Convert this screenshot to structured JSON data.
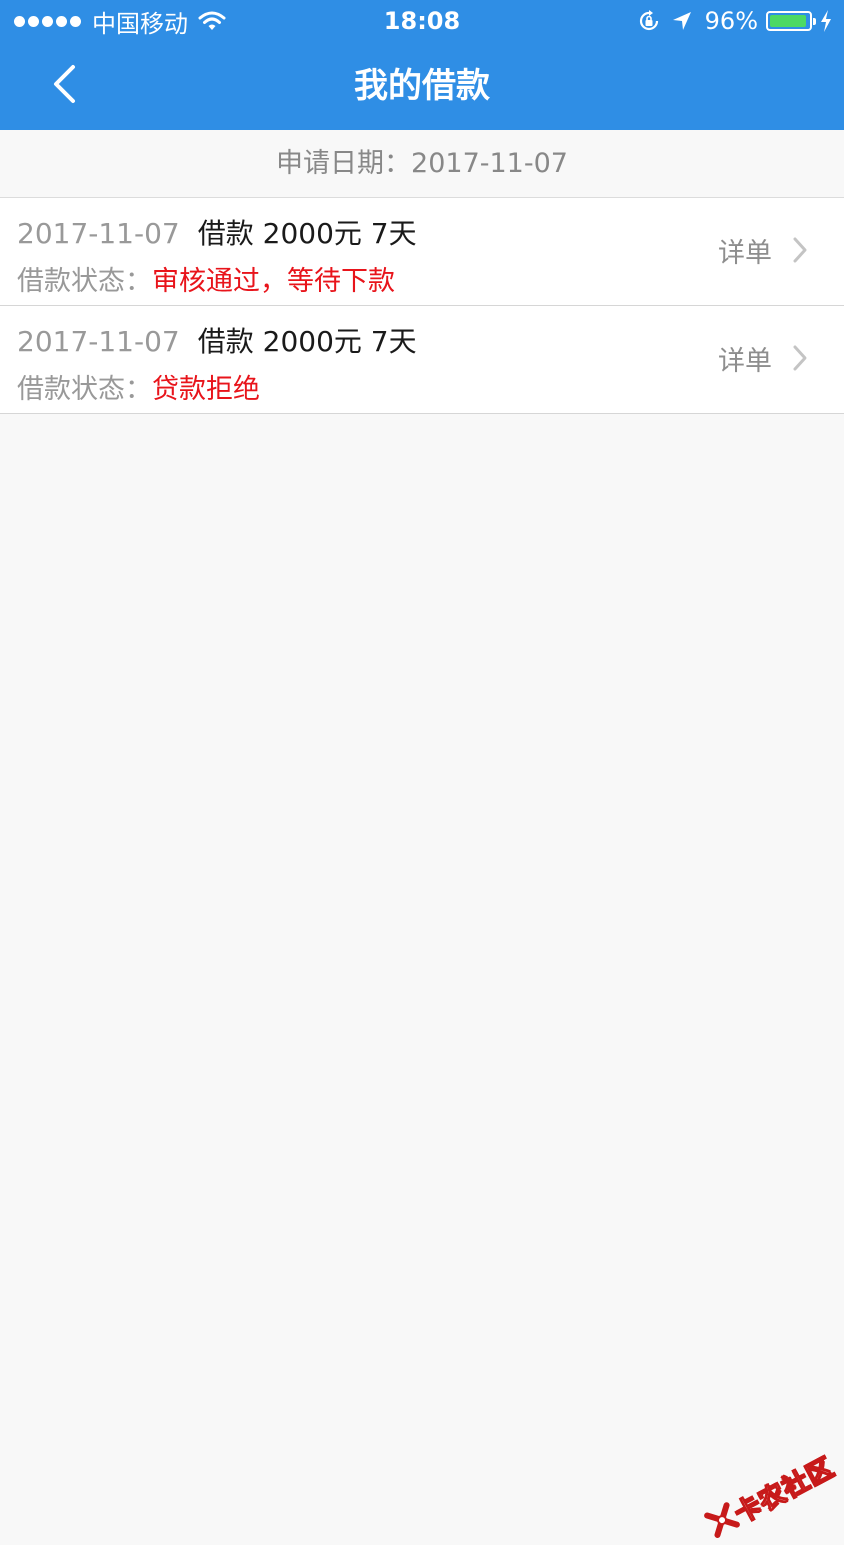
{
  "status_bar": {
    "carrier": "中国移动",
    "time": "18:08",
    "battery_percent": "96%",
    "battery_level": 0.96,
    "icons": [
      "signal-dots-icon",
      "wifi-icon",
      "rotation-lock-icon",
      "location-arrow-icon",
      "battery-icon",
      "charging-bolt-icon"
    ]
  },
  "nav": {
    "title": "我的借款",
    "back_icon": "chevron-left-icon"
  },
  "date_header": {
    "text": "申请日期：2017-11-07"
  },
  "loans": [
    {
      "date": "2017-11-07",
      "desc": "借款 2000元 7天",
      "status_label": "借款状态：",
      "status_value": "审核通过，等待下款",
      "detail_label": "详单"
    },
    {
      "date": "2017-11-07",
      "desc": "借款 2000元 7天",
      "status_label": "借款状态：",
      "status_value": "贷款拒绝",
      "detail_label": "详单"
    }
  ],
  "watermark": {
    "text": "卡农社区"
  },
  "colors": {
    "primary": "#2f8ee5",
    "status_red": "#e8141b",
    "background": "#f8f8f8",
    "battery_green": "#4cd964"
  }
}
